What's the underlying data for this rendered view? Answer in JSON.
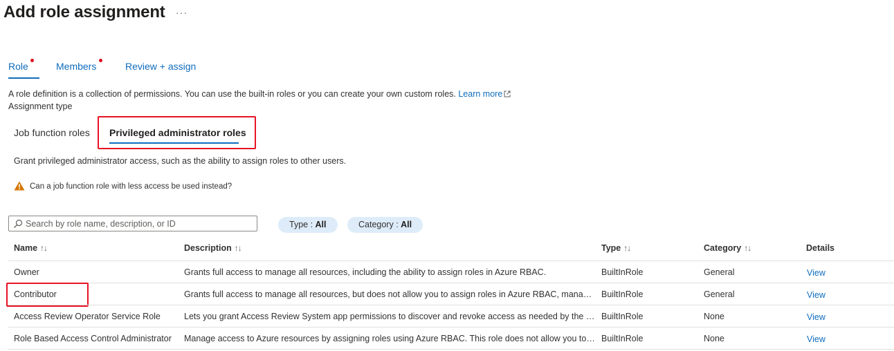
{
  "page": {
    "title": "Add role assignment",
    "more": "···"
  },
  "tabs": [
    {
      "label": "Role"
    },
    {
      "label": "Members"
    },
    {
      "label": "Review + assign"
    }
  ],
  "description": {
    "text": "A role definition is a collection of permissions. You can use the built-in roles or you can create your own custom roles.",
    "learn_more": "Learn more",
    "assignment_type": "Assignment type"
  },
  "subtabs": [
    {
      "label": "Job function roles"
    },
    {
      "label": "Privileged administrator roles"
    }
  ],
  "grant_text": "Grant privileged administrator access, such as the ability to assign roles to other users.",
  "warning_text": "Can a job function role with less access be used instead?",
  "search": {
    "placeholder": "Search by role name, description, or ID"
  },
  "filters": [
    {
      "label": "Type : ",
      "value": "All"
    },
    {
      "label": "Category : ",
      "value": "All"
    }
  ],
  "table": {
    "headers": [
      "Name",
      "Description",
      "Type",
      "Category",
      "Details"
    ],
    "sort_glyph": "↑↓",
    "rows": [
      {
        "name": "Owner",
        "description": "Grants full access to manage all resources, including the ability to assign roles in Azure RBAC.",
        "type": "BuiltInRole",
        "category": "General",
        "details": "View"
      },
      {
        "name": "Contributor",
        "description": "Grants full access to manage all resources, but does not allow you to assign roles in Azure RBAC, manage assignments in Azure Blueprints, or share image galleries.",
        "type": "BuiltInRole",
        "category": "General",
        "details": "View"
      },
      {
        "name": "Access Review Operator Service Role",
        "description": "Lets you grant Access Review System app permissions to discover and revoke access as needed by the access review process.",
        "type": "BuiltInRole",
        "category": "None",
        "details": "View"
      },
      {
        "name": "Role Based Access Control Administrator",
        "description": "Manage access to Azure resources by assigning roles using Azure RBAC. This role does not allow you to manage access using other ways, such as Azure Policy.",
        "type": "BuiltInRole",
        "category": "None",
        "details": "View"
      }
    ]
  },
  "colors": {
    "accent": "#0f6cbd",
    "highlight_box": "#e81123",
    "pill_bg": "#deecf9",
    "warning": "#d47500",
    "required_dot": "#e00b1c"
  }
}
